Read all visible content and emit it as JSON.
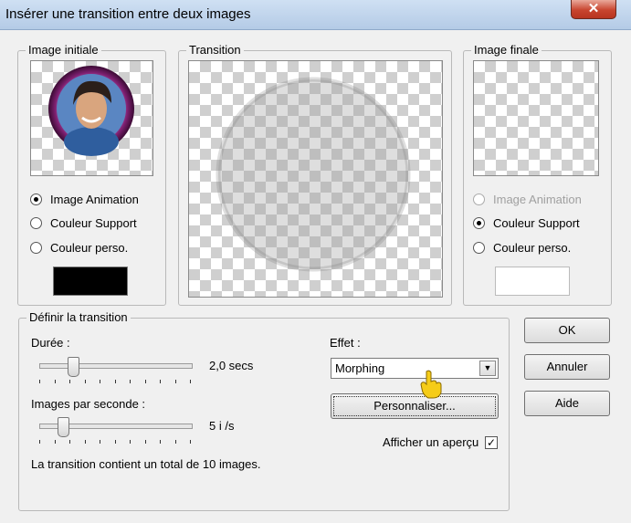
{
  "window": {
    "title": "Insérer une transition entre deux images"
  },
  "close_glyph": "✕",
  "initial": {
    "label": "Image initiale",
    "radios": [
      "Image Animation",
      "Couleur Support",
      "Couleur perso."
    ],
    "selected": 0,
    "swatch_color": "#000000"
  },
  "transition": {
    "label": "Transition"
  },
  "final": {
    "label": "Image finale",
    "radios": [
      "Image Animation",
      "Couleur Support",
      "Couleur perso."
    ],
    "selected": 1,
    "disabled_index": 0,
    "swatch_color": "#ffffff"
  },
  "define": {
    "label": "Définir la transition",
    "duration_label": "Durée :",
    "duration_value": "2,0 secs",
    "duration_level": 0.2,
    "fps_label": "Images par seconde :",
    "fps_value": "5 i /s",
    "fps_level": 0.13,
    "summary": "La transition contient un total de 10 images.",
    "effect_label": "Effet :",
    "effect_value": "Morphing",
    "customize_label": "Personnaliser...",
    "preview_label": "Afficher un aperçu",
    "preview_checked": true
  },
  "buttons": {
    "ok": "OK",
    "cancel": "Annuler",
    "help": "Aide"
  }
}
